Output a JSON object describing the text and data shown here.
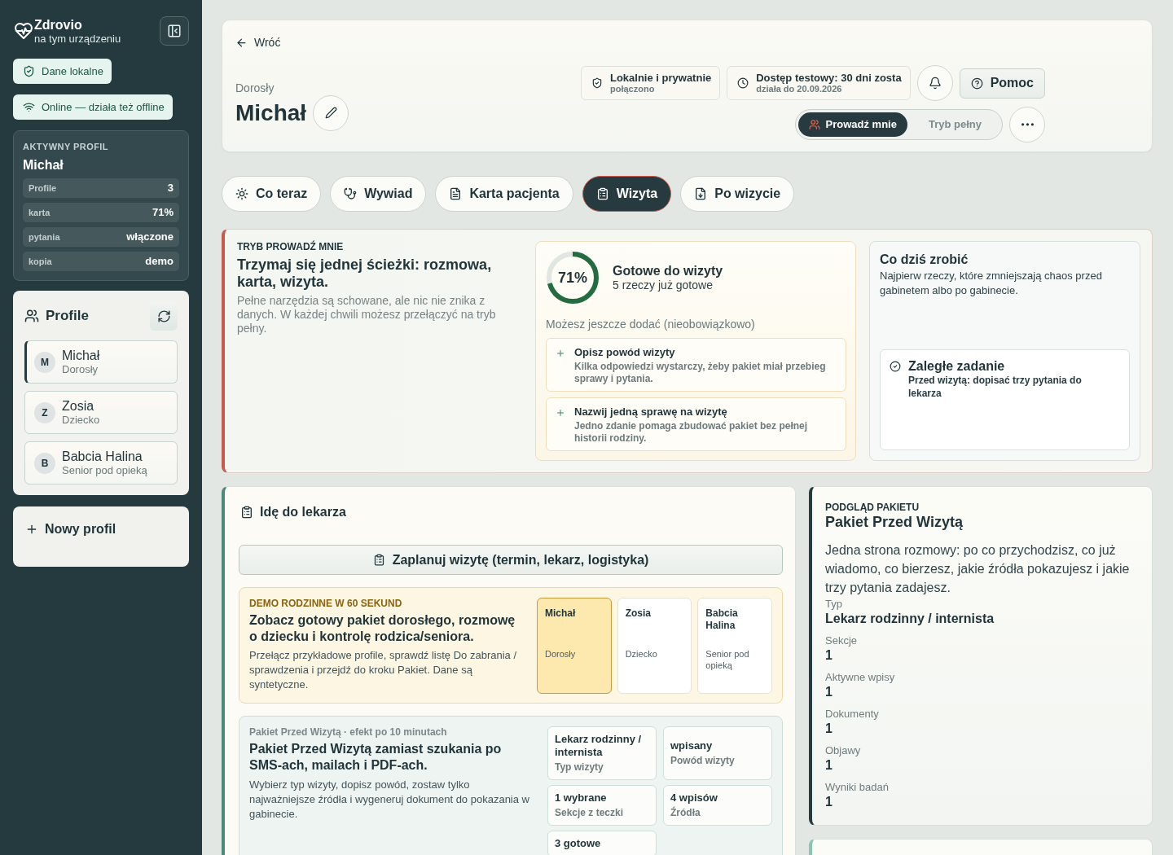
{
  "sidebar": {
    "brand": {
      "name": "Zdrovio",
      "tagline": "na tym urządzeniu"
    },
    "badges": [
      {
        "label": "Dane lokalne"
      },
      {
        "label": "Online — działa też offline"
      }
    ],
    "active_profile": {
      "heading": "AKTYWNY PROFIL",
      "name": "Michał",
      "stats": [
        {
          "label": "Profile",
          "value": "3"
        },
        {
          "label": "karta",
          "value": "71%"
        },
        {
          "label": "pytania",
          "value": "włączone"
        },
        {
          "label": "kopia",
          "value": "demo"
        }
      ]
    },
    "profiles": {
      "title": "Profile",
      "items": [
        {
          "initial": "M",
          "name": "Michał",
          "role": "Dorosły",
          "selected": true
        },
        {
          "initial": "Z",
          "name": "Zosia",
          "role": "Dziecko",
          "selected": false
        },
        {
          "initial": "B",
          "name": "Babcia Halina",
          "role": "Senior pod opieką",
          "selected": false
        }
      ]
    },
    "new_profile": "Nowy profil"
  },
  "header": {
    "back": "Wróć",
    "role": "Dorosły",
    "name": "Michał",
    "chips": [
      {
        "title": "Lokalnie i prywatnie",
        "subtitle": "połączono"
      },
      {
        "title": "Dostęp testowy: 30 dni zosta",
        "subtitle": "działa do 20.09.2026"
      }
    ],
    "help": "Pomoc",
    "modes": [
      {
        "label": "Prowadź mnie",
        "selected": true
      },
      {
        "label": "Tryb pełny",
        "selected": false
      }
    ]
  },
  "tabs": [
    {
      "label": "Co teraz",
      "selected": false
    },
    {
      "label": "Wywiad",
      "selected": false
    },
    {
      "label": "Karta pacjenta",
      "selected": false
    },
    {
      "label": "Wizyta",
      "selected": true
    },
    {
      "label": "Po wizycie",
      "selected": false
    }
  ],
  "guide": {
    "eyebrow": "TRYB PROWADŹ MNIE",
    "title": "Trzymaj się jednej ścieżki: rozmowa, karta, wizyta.",
    "text": "Pełne narzędzia są schowane, ale nic nie znika z danych. W każdej chwili możesz przełączyć na tryb pełny.",
    "readiness": {
      "level": 0.71,
      "percent": "71%",
      "title": "Gotowe do wizyty",
      "subtitle": "5 rzeczy już gotowe",
      "optional_label": "Możesz jeszcze dodać (nieobowiązkowo)",
      "suggestions": [
        {
          "title": "Opisz powód wizyty",
          "text": "Kilka odpowiedzi wystarczy, żeby pakiet miał przebieg sprawy i pytania."
        },
        {
          "title": "Nazwij jedną sprawę na wizytę",
          "text": "Jedno zdanie pomaga zbudować pakiet bez pełnej historii rodziny."
        }
      ]
    },
    "today": {
      "title": "Co dziś zrobić",
      "text": "Najpierw rzeczy, które zmniejszają chaos przed gabinetem albo po gabinecie.",
      "task": {
        "title": "Zaległe zadanie",
        "text": "Przed wizytą: dopisać trzy pytania do lekarza"
      }
    }
  },
  "visit": {
    "title": "Idę do lekarza",
    "plan_button": "Zaplanuj wizytę (termin, lekarz, logistyka)",
    "demo": {
      "eyebrow": "DEMO RODZINNE W 60 SEKUND",
      "title": "Zobacz gotowy pakiet dorosłego, rozmowę o dziecku i kontrolę rodzica/seniora.",
      "text": "Przełącz przykładowe profile, sprawdź listę Do zabrania / sprawdzenia i przejdź do kroku Pakiet. Dane są syntetyczne.",
      "profiles": [
        {
          "name": "Michał",
          "role": "Dorosły",
          "selected": true
        },
        {
          "name": "Zosia",
          "role": "Dziecko",
          "selected": false
        },
        {
          "name": "Babcia Halina",
          "role": "Senior pod opieką",
          "selected": false
        }
      ]
    },
    "package": {
      "eyebrow": "Pakiet Przed Wizytą · efekt po 10 minutach",
      "title": "Pakiet Przed Wizytą zamiast szukania po SMS-ach, mailach i PDF-ach.",
      "text": "Wybierz typ wizyty, dopisz powód, zostaw tylko najważniejsze źródła i wygeneruj dokument do pokazania w gabinecie.",
      "facts": [
        {
          "value": "Lekarz rodzinny / internista",
          "label": "Typ wizyty"
        },
        {
          "value": "wpisany",
          "label": "Powód wizyty"
        },
        {
          "value": "1 wybrane",
          "label": "Sekcje z teczki"
        },
        {
          "value": "4 wpisów",
          "label": "Źródła"
        },
        {
          "value": "3 gotowe"
        }
      ]
    }
  },
  "preview": {
    "eyebrow": "PODGLĄD PAKIETU",
    "title": "Pakiet Przed Wizytą",
    "text": "Jedna strona rozmowy: po co przychodzisz, co już wiadomo, co bierzesz, jakie źródła pokazujesz i jakie trzy pytania zadajesz.",
    "fields": [
      {
        "label": "Typ",
        "value": "Lekarz rodzinny / internista"
      },
      {
        "label": "Sekcje",
        "value": "1"
      },
      {
        "label": "Aktywne wpisy",
        "value": "1"
      },
      {
        "label": "Dokumenty",
        "value": "1"
      },
      {
        "label": "Objawy",
        "value": "1"
      },
      {
        "label": "Wyniki badań",
        "value": "1"
      }
    ]
  }
}
